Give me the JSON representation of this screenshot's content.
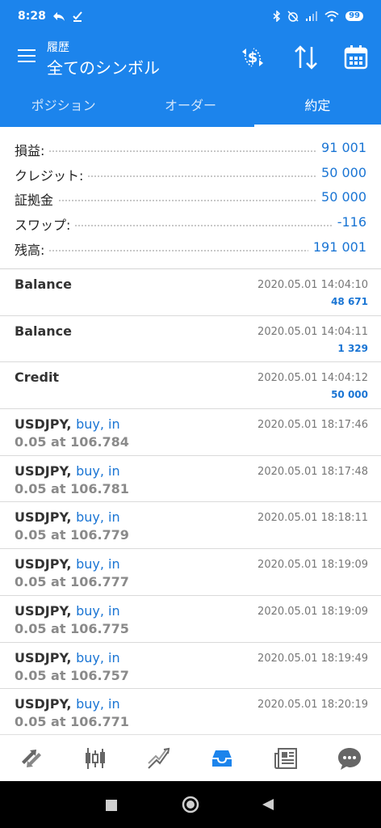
{
  "status_bar": {
    "time": "8:28",
    "battery": "99"
  },
  "header": {
    "subtitle": "履歴",
    "title": "全てのシンボル"
  },
  "tabs": [
    {
      "label": "ポジション"
    },
    {
      "label": "オーダー"
    },
    {
      "label": "約定"
    }
  ],
  "summary": [
    {
      "label": "損益:",
      "value": "91 001"
    },
    {
      "label": "クレジット:",
      "value": "50 000"
    },
    {
      "label": "証拠金",
      "value": "50 000"
    },
    {
      "label": "スワップ:",
      "value": "-116"
    },
    {
      "label": "残高:",
      "value": "191 001"
    }
  ],
  "deals": [
    {
      "title": "Balance",
      "date": "2020.05.01 14:04:10",
      "amount": "48 671"
    },
    {
      "title": "Balance",
      "date": "2020.05.01 14:04:11",
      "amount": "1 329"
    },
    {
      "title": "Credit",
      "date": "2020.05.01 14:04:12",
      "amount": "50 000"
    },
    {
      "symbol": "USDJPY,",
      "action": "buy, in",
      "detail": "0.05 at 106.784",
      "date": "2020.05.01 18:17:46"
    },
    {
      "symbol": "USDJPY,",
      "action": "buy, in",
      "detail": "0.05 at 106.781",
      "date": "2020.05.01 18:17:48"
    },
    {
      "symbol": "USDJPY,",
      "action": "buy, in",
      "detail": "0.05 at 106.779",
      "date": "2020.05.01 18:18:11"
    },
    {
      "symbol": "USDJPY,",
      "action": "buy, in",
      "detail": "0.05 at 106.777",
      "date": "2020.05.01 18:19:09"
    },
    {
      "symbol": "USDJPY,",
      "action": "buy, in",
      "detail": "0.05 at 106.775",
      "date": "2020.05.01 18:19:09"
    },
    {
      "symbol": "USDJPY,",
      "action": "buy, in",
      "detail": "0.05 at 106.757",
      "date": "2020.05.01 18:19:49"
    },
    {
      "symbol": "USDJPY,",
      "action": "buy, in",
      "detail": "0.05 at 106.771",
      "date": "2020.05.01 18:20:19"
    }
  ],
  "bottom_nav": [
    "quotes-icon",
    "chart-icon",
    "trade-icon",
    "history-icon",
    "news-icon",
    "chat-icon"
  ],
  "colors": {
    "primary": "#1c84ec",
    "accent_text": "#1a75d4"
  }
}
